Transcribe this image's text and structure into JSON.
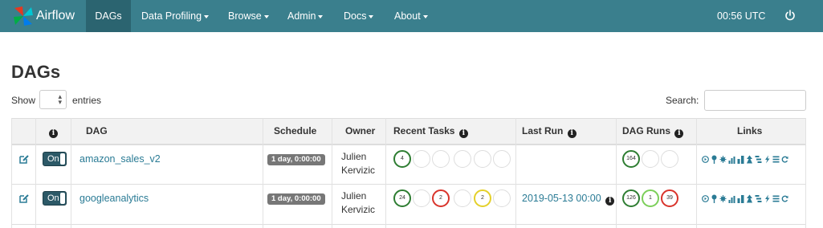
{
  "navbar": {
    "brand": "Airflow",
    "items": [
      {
        "label": "DAGs",
        "active": true
      },
      {
        "label": "Data Profiling",
        "dropdown": true
      },
      {
        "label": "Browse",
        "dropdown": true
      },
      {
        "label": "Admin",
        "dropdown": true
      },
      {
        "label": "Docs",
        "dropdown": true
      },
      {
        "label": "About",
        "dropdown": true
      }
    ],
    "time": "00:56 UTC",
    "power_icon": "power-icon"
  },
  "page": {
    "title": "DAGs",
    "show_label": "Show",
    "entries_label": "entries",
    "search_label": "Search:",
    "search_value": ""
  },
  "table": {
    "headers": {
      "dag": "DAG",
      "schedule": "Schedule",
      "owner": "Owner",
      "recent_tasks": "Recent Tasks",
      "last_run": "Last Run",
      "dag_runs": "DAG Runs",
      "links": "Links"
    },
    "rows": [
      {
        "toggle": "On",
        "dag": "amazon_sales_v2",
        "schedule": "1 day, 0:00:00",
        "owner_line1": "Julien",
        "owner_line2": "Kervizic",
        "recent_tasks": [
          "4",
          "",
          "",
          "",
          "",
          ""
        ],
        "last_run": "",
        "dag_runs": [
          "164",
          "",
          ""
        ]
      },
      {
        "toggle": "On",
        "dag": "googleanalytics",
        "schedule": "1 day, 0:00:00",
        "owner_line1": "Julien",
        "owner_line2": "Kervizic",
        "recent_tasks": [
          "24",
          "",
          "2",
          "",
          "2",
          ""
        ],
        "last_run": "2019-05-13 00:00",
        "dag_runs": [
          "126",
          "1",
          "39"
        ]
      }
    ]
  },
  "colors": {
    "navbar": "#3a7f8d",
    "link": "#2a7b95",
    "success": "#2e7d32",
    "failed": "#d9342b",
    "retry": "#e4d02a",
    "running": "#7ccf5a"
  }
}
